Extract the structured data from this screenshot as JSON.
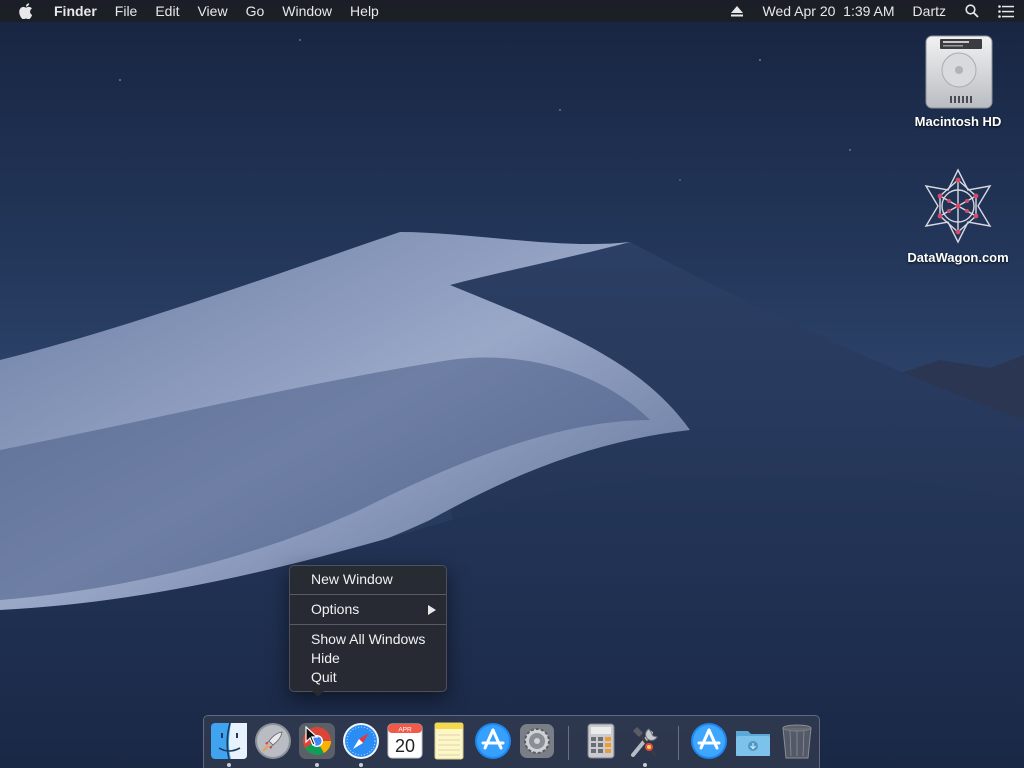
{
  "menubar": {
    "apple_icon": "apple-logo-icon",
    "app_name": "Finder",
    "menus": [
      "File",
      "Edit",
      "View",
      "Go",
      "Window",
      "Help"
    ],
    "eject_icon": "eject-icon",
    "datetime": "Wed Apr 20  1:39 AM",
    "user": "Dartz",
    "spotlight_icon": "search-icon",
    "notification_icon": "list-icon"
  },
  "desktop_icons": [
    {
      "label": "Macintosh HD",
      "icon": "hard-drive-icon"
    },
    {
      "label": "DataWagon.com",
      "icon": "geometric-star-icon"
    }
  ],
  "context_menu": {
    "items": [
      "New Window",
      "Options",
      "Show All Windows",
      "Hide",
      "Quit"
    ]
  },
  "dock": {
    "calendar_month": "APR",
    "calendar_day": "20",
    "apps": [
      {
        "name": "Finder",
        "icon": "finder-icon",
        "running": true
      },
      {
        "name": "Launchpad",
        "icon": "rocket-icon",
        "running": false
      },
      {
        "name": "Chrome",
        "icon": "chrome-icon",
        "running": true
      },
      {
        "name": "Safari",
        "icon": "compass-icon",
        "running": true
      },
      {
        "name": "Calendar",
        "icon": "calendar-icon",
        "running": false
      },
      {
        "name": "Notes",
        "icon": "notes-icon",
        "running": false
      },
      {
        "name": "App Store",
        "icon": "app-store-icon",
        "running": false
      },
      {
        "name": "System Preferences",
        "icon": "gear-icon",
        "running": false
      },
      {
        "name": "Calculator",
        "icon": "calculator-icon",
        "running": false
      },
      {
        "name": "Utilities",
        "icon": "tools-icon",
        "running": true
      },
      {
        "name": "Applications",
        "icon": "app-store-folder-icon",
        "running": false
      },
      {
        "name": "Downloads",
        "icon": "folder-icon",
        "running": false
      },
      {
        "name": "Trash",
        "icon": "trash-icon",
        "running": false
      }
    ]
  }
}
